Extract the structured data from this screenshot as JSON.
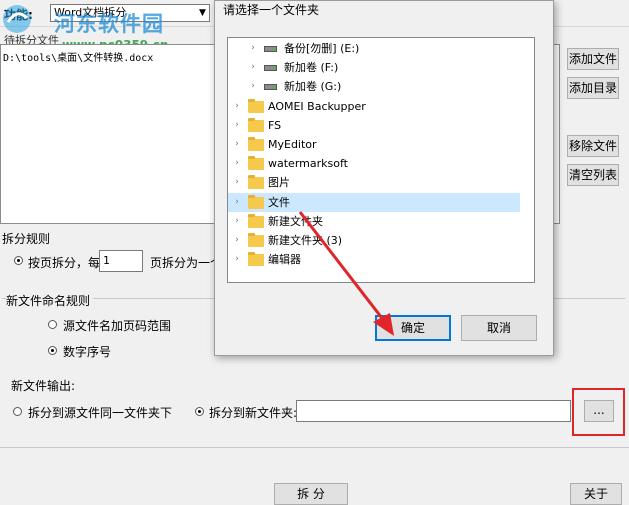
{
  "app": {
    "func_label": "功能:",
    "func_value": "Word文档拆分",
    "file_list_caption": "待拆分文件",
    "file_rows": [
      "D:\\tools\\桌面\\文件转换.docx"
    ],
    "buttons": {
      "add_file": "添加文件",
      "add_dir": "添加目录",
      "remove_file": "移除文件",
      "clear_list": "清空列表",
      "split": "拆 分",
      "close": "关于",
      "browse": "..."
    },
    "split_rules": {
      "label": "拆分规则",
      "by_page_prefix": "按页拆分，每",
      "page_count": "1",
      "by_page_suffix": "页拆分为一个"
    },
    "naming": {
      "label": "新文件命名规则",
      "option_range": "源文件名加页码范围",
      "option_seq": "数字序号"
    },
    "output": {
      "label": "新文件输出:",
      "option_same": "拆分到源文件同一文件夹下",
      "option_new": "拆分到新文件夹:",
      "path_value": ""
    }
  },
  "watermark": {
    "site_name": "河东软件园",
    "site_url": "www.pc0359.cn"
  },
  "dialog": {
    "title": "请选择一个文件夹",
    "tree": [
      {
        "label": "备份[勿删] (E:)",
        "kind": "drive",
        "indent": 2
      },
      {
        "label": "新加卷 (F:)",
        "kind": "drive",
        "indent": 2
      },
      {
        "label": "新加卷 (G:)",
        "kind": "drive",
        "indent": 2
      },
      {
        "label": "AOMEI Backupper",
        "kind": "folder",
        "indent": 1
      },
      {
        "label": "FS",
        "kind": "folder",
        "indent": 1
      },
      {
        "label": "MyEditor",
        "kind": "folder",
        "indent": 1
      },
      {
        "label": "watermarksoft",
        "kind": "folder",
        "indent": 1
      },
      {
        "label": "图片",
        "kind": "folder",
        "indent": 1
      },
      {
        "label": "文件",
        "kind": "folder",
        "indent": 1,
        "selected": true
      },
      {
        "label": "新建文件夹",
        "kind": "folder",
        "indent": 1
      },
      {
        "label": "新建文件夹 (3)",
        "kind": "folder",
        "indent": 1
      },
      {
        "label": "编辑器",
        "kind": "folder",
        "indent": 1
      }
    ],
    "ok": "确定",
    "cancel": "取消"
  },
  "colors": {
    "annotation_red": "#e0262a",
    "selection": "#cce8ff",
    "focus_blue": "#0078d7"
  }
}
